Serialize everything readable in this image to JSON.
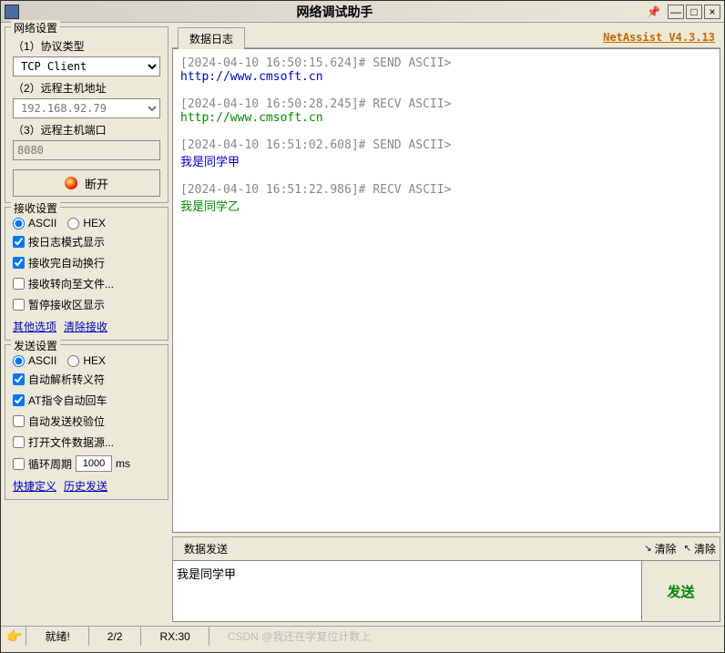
{
  "window": {
    "title": "网络调试助手"
  },
  "brand": "NetAssist V4.3.13",
  "network": {
    "title": "网络设置",
    "protocol_label": "（1）协议类型",
    "protocol_value": "TCP Client",
    "host_label": "（2）远程主机地址",
    "host_value": "192.168.92.79",
    "port_label": "（3）远程主机端口",
    "port_value": "8080",
    "disconnect_label": "断开"
  },
  "recv": {
    "title": "接收设置",
    "ascii": "ASCII",
    "hex": "HEX",
    "opts": [
      "按日志模式显示",
      "接收完自动换行",
      "接收转向至文件...",
      "暂停接收区显示"
    ],
    "checked": [
      true,
      true,
      false,
      false
    ],
    "link1": "其他选项",
    "link2": "清除接收"
  },
  "send": {
    "title": "发送设置",
    "ascii": "ASCII",
    "hex": "HEX",
    "opts": [
      "自动解析转义符",
      "AT指令自动回车",
      "自动发送校验位",
      "打开文件数据源..."
    ],
    "checked": [
      true,
      true,
      false,
      false
    ],
    "cycle_label": "循环周期",
    "cycle_value": "1000",
    "cycle_unit": "ms",
    "link1": "快捷定义",
    "link2": "历史发送"
  },
  "log_tab": "数据日志",
  "log": [
    {
      "ts": "[2024-04-10 16:50:15.624]# SEND ASCII>",
      "body": "http://www.cmsoft.cn",
      "type": "send"
    },
    {
      "ts": "[2024-04-10 16:50:28.245]# RECV ASCII>",
      "body": "http://www.cmsoft.cn",
      "type": "recv"
    },
    {
      "ts": "[2024-04-10 16:51:02.608]# SEND ASCII>",
      "body": "我是同学甲",
      "type": "send"
    },
    {
      "ts": "[2024-04-10 16:51:22.986]# RECV ASCII>",
      "body": "我是同学乙",
      "type": "recv"
    }
  ],
  "sendbox": {
    "tab": "数据发送",
    "clear1": "清除",
    "clear2": "清除",
    "input": "我是同学甲",
    "button": "发送"
  },
  "status": {
    "ready": "就绪!",
    "count": "2/2",
    "rx": "RX:30",
    "watermark": "CSDN @我还在学复位计数上"
  }
}
